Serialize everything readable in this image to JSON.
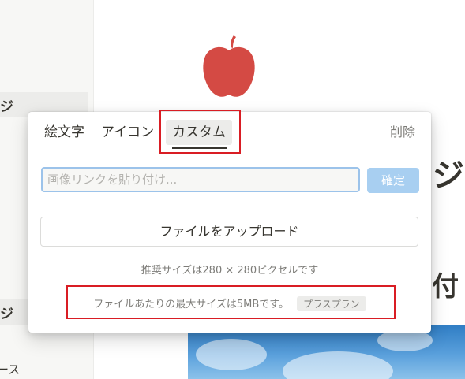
{
  "sidebar": {
    "items": [
      {
        "text": "ジ"
      },
      {
        "text": "ジ"
      },
      {
        "text": "ース"
      }
    ]
  },
  "page": {
    "heading_fragments": [
      "ジ",
      "付"
    ]
  },
  "image_picker": {
    "tabs": [
      {
        "label": "絵文字"
      },
      {
        "label": "アイコン"
      },
      {
        "label": "カスタム",
        "active": true
      }
    ],
    "remove_label": "削除",
    "url_input": {
      "value": "",
      "placeholder": "画像リンクを貼り付け..."
    },
    "confirm_label": "確定",
    "upload_label": "ファイルをアップロード",
    "recommended_size": "推奨サイズは280 × 280ピクセルです",
    "file_limit": "ファイルあたりの最大サイズは5MBです。",
    "plan_badge": "プラスプラン"
  },
  "colors": {
    "accent_red": "#d91d24",
    "confirm_button": "#a8cff1",
    "input_border": "#9cc3ea",
    "apple": "#d44a44"
  },
  "icons": [
    "apple-icon"
  ]
}
